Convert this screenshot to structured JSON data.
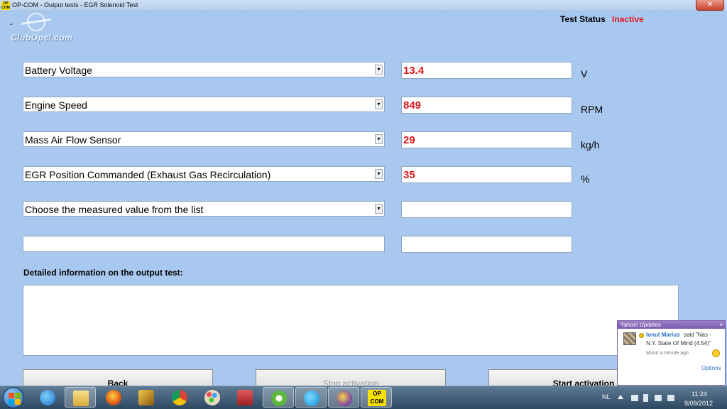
{
  "window": {
    "app_badge": "OP COM",
    "title": "OP-COM - Output tests - EGR Solenoid Test",
    "close_glyph": "✕"
  },
  "logo": {
    "dash": "-",
    "text": "ClubOpel.com"
  },
  "status": {
    "label": "Test Status",
    "value": "Inactive",
    "value_color": "#e0161b"
  },
  "measurements": [
    {
      "label": "Battery Voltage",
      "value": "13.4",
      "unit": "V"
    },
    {
      "label": "Engine Speed",
      "value": "849",
      "unit": "RPM"
    },
    {
      "label": "Mass Air Flow Sensor",
      "value": "29",
      "unit": "kg/h"
    },
    {
      "label": "EGR Position Commanded (Exhaust Gas Recirculation)",
      "value": "35",
      "unit": "%"
    },
    {
      "label": "Choose the measured value from the list",
      "value": "",
      "unit": ""
    }
  ],
  "combo_arrow": "▾",
  "detail": {
    "label": "Detailed information on the output test:",
    "text": ""
  },
  "buttons": {
    "back": "Back",
    "stop": "Stop activation",
    "start": "Start activation"
  },
  "yahoo": {
    "title": "Yahoo! Updates",
    "close": "×",
    "name": "Ionut Marius",
    "said": "said \"Nas -",
    "song": "N.Y. State Of Mind (4:54)\"",
    "time": "about a minute ago",
    "options": "Options"
  },
  "taskbar": {
    "language": "NL",
    "time": "11:24",
    "date": "9/09/2012",
    "opcom_badge": "OP COM"
  },
  "icons": [
    "windows-start-icon",
    "internet-explorer-icon",
    "file-explorer-icon",
    "firefox-icon",
    "winamp-icon",
    "chrome-icon",
    "paint-icon",
    "media-icon",
    "utorrent-icon",
    "skype-icon",
    "yahoo-messenger-icon",
    "opcom-icon"
  ]
}
